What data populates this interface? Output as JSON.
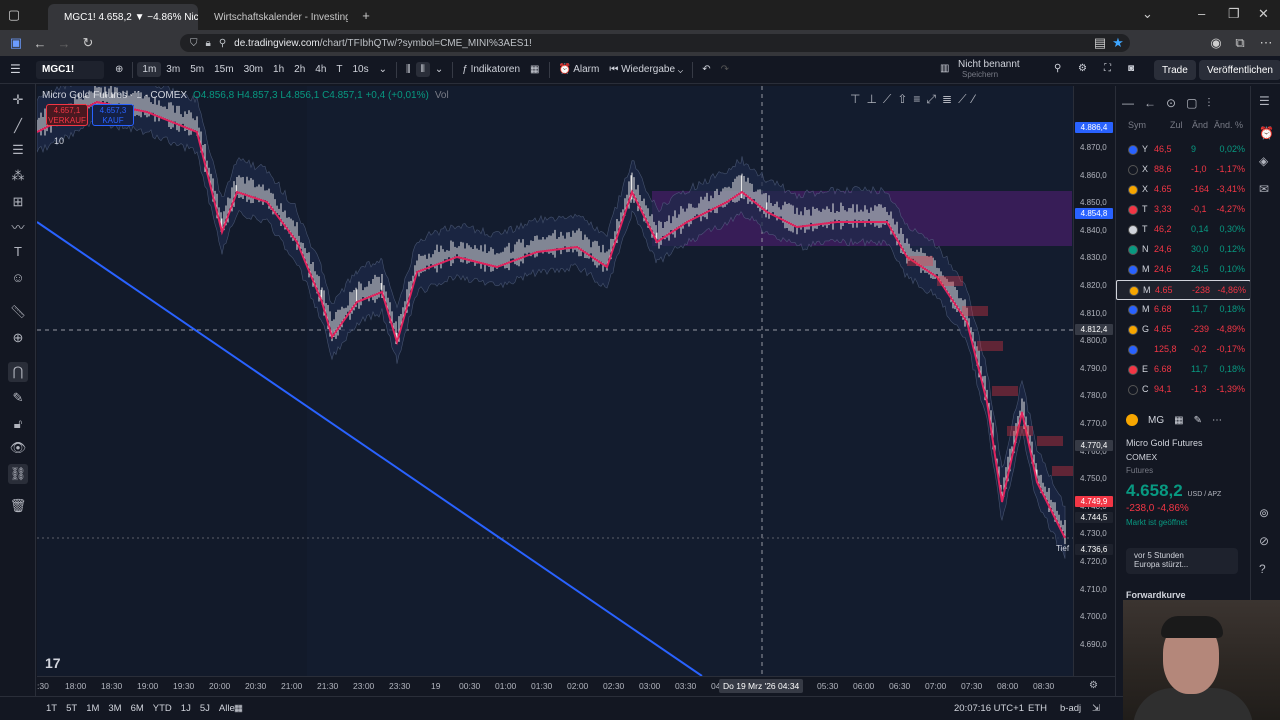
{
  "browser": {
    "tabs": [
      {
        "label": "MGC1! 4.658,2 ▼ −4.86% Nicht",
        "active": true
      },
      {
        "label": "Wirtschaftskalender - Investing",
        "active": false
      }
    ],
    "new_tab": "+",
    "url_host": "de.tradingview.com",
    "url_path": "/chart/TFIbhQTw/?symbol=CME_MINI%3AES1!"
  },
  "toolbar": {
    "symbol": "MGC1!",
    "intervals": [
      "1m",
      "3m",
      "5m",
      "15m",
      "30m",
      "1h",
      "2h",
      "4h",
      "T",
      "10s"
    ],
    "active_interval": "1m",
    "indicators": "Indikatoren",
    "alarm": "Alarm",
    "replay": "Wiedergabe",
    "layout_name": "Nicht benannt",
    "layout_sub": "Speichern",
    "trade": "Trade",
    "publish": "Veröffentlichen"
  },
  "legend": {
    "title": "Micro Gold Futures · 1 · COMEX",
    "o": "O4.856,8",
    "h": "H4.857,3",
    "l": "L4.856,1",
    "c": "C4.857,1",
    "chg": "+0,4 (+0,01%)",
    "vol": "Vol",
    "sell_price": "4.657,1",
    "sell_label": "VERKAUF",
    "buy_price": "4.657,3",
    "buy_label": "KAUF",
    "qty": "10"
  },
  "price_axis": {
    "ticks": [
      "4.870,0",
      "4.860,0",
      "4.850,0",
      "4.840,0",
      "4.830,0",
      "4.820,0",
      "4.810,0",
      "4.800,0",
      "4.790,0",
      "4.780,0",
      "4.770,0",
      "4.760,0",
      "4.750,0",
      "4.740,0",
      "4.730,0",
      "4.720,0",
      "4.710,0",
      "4.700,0",
      "4.690,0"
    ],
    "labels": [
      {
        "text": "4.886,4",
        "color": "#2962ff"
      },
      {
        "text": "4.854,8",
        "color": "#2962ff"
      },
      {
        "text": "4.812,4",
        "color": "#363a45"
      },
      {
        "text": "4.770,4",
        "color": "#363a45"
      },
      {
        "text": "4.749,9",
        "color": "#f23645"
      },
      {
        "text": "4.744,5",
        "color": "#1e222d"
      },
      {
        "text": "4.736,6",
        "color": "#1e222d"
      }
    ],
    "tief": "Tief"
  },
  "time_axis": {
    "ticks": [
      ":30",
      "18:00",
      "18:30",
      "19:00",
      "19:30",
      "20:00",
      "20:30",
      "21:00",
      "21:30",
      "23:00",
      "23:30",
      "19",
      "00:30",
      "01:00",
      "01:30",
      "02:00",
      "02:30",
      "03:00",
      "03:30",
      "04",
      "05:30",
      "06:00",
      "06:30",
      "07:00",
      "07:30",
      "08:00",
      "08:30"
    ],
    "cursor": "Do 19 Mrz '26  04:34"
  },
  "bottom": {
    "ranges": [
      "1T",
      "5T",
      "1M",
      "3M",
      "6M",
      "YTD",
      "1J",
      "5J",
      "Alle"
    ],
    "clock": "20:07:16 UTC+1",
    "session": "ETH",
    "adj": "b-adj"
  },
  "watchlist": {
    "headers": [
      "Sym",
      "Zul",
      "Änd",
      "Änd. %"
    ],
    "rows": [
      {
        "icon_color": "#2962ff",
        "sym": "Y",
        "last": "46,5",
        "chg": "9",
        "pct": "0,02%",
        "up": true
      },
      {
        "icon_color": "#131722",
        "sym": "X",
        "last": "88,6",
        "chg": "-1,0",
        "pct": "-1,17%",
        "up": false
      },
      {
        "icon_color": "#f7a600",
        "sym": "X",
        "last": "4.65",
        "chg": "-164",
        "pct": "-3,41%",
        "up": false
      },
      {
        "icon_color": "#f23645",
        "sym": "T",
        "last": "3,33",
        "chg": "-0,1",
        "pct": "-4,27%",
        "up": false
      },
      {
        "icon_color": "#d1d4dc",
        "sym": "T",
        "last": "46,2",
        "chg": "0,14",
        "pct": "0,30%",
        "up": true
      },
      {
        "icon_color": "#089981",
        "sym": "N",
        "last": "24,6",
        "chg": "30,0",
        "pct": "0,12%",
        "up": true
      },
      {
        "icon_color": "#2962ff",
        "sym": "M",
        "last": "24,6",
        "chg": "24,5",
        "pct": "0,10%",
        "up": true
      },
      {
        "icon_color": "#f7a600",
        "sym": "M",
        "last": "4.65",
        "chg": "-238",
        "pct": "-4,86%",
        "up": false,
        "selected": true
      },
      {
        "icon_color": "#2962ff",
        "sym": "M",
        "last": "6.68",
        "chg": "11,7",
        "pct": "0,18%",
        "up": true
      },
      {
        "icon_color": "#f7a600",
        "sym": "G",
        "last": "4.65",
        "chg": "-239",
        "pct": "-4,89%",
        "up": false
      },
      {
        "icon_color": "#2962ff",
        "sym": "",
        "last": "125,8",
        "chg": "-0,2",
        "pct": "-0,17%",
        "up": false
      },
      {
        "icon_color": "#f23645",
        "sym": "E",
        "last": "6.68",
        "chg": "11,7",
        "pct": "0,18%",
        "up": true
      },
      {
        "icon_color": "#131722",
        "sym": "C",
        "last": "94,1",
        "chg": "-1,3",
        "pct": "-1,39%",
        "up": false
      }
    ]
  },
  "detail": {
    "short": "MG",
    "name": "Micro Gold Futures",
    "exchange": "COMEX",
    "type": "Futures",
    "price": "4.658,2",
    "currency": "USD / APZ",
    "change": "-238,0  -4,86%",
    "status": "Markt ist geöffnet",
    "news_time": "vor 5 Stunden",
    "news_text": "Europa stürzt...",
    "forward": "Forwardkurve"
  },
  "colors": {
    "up": "#089981",
    "down": "#f23645",
    "accent": "#2962ff",
    "zone": "#7b1fa2"
  }
}
